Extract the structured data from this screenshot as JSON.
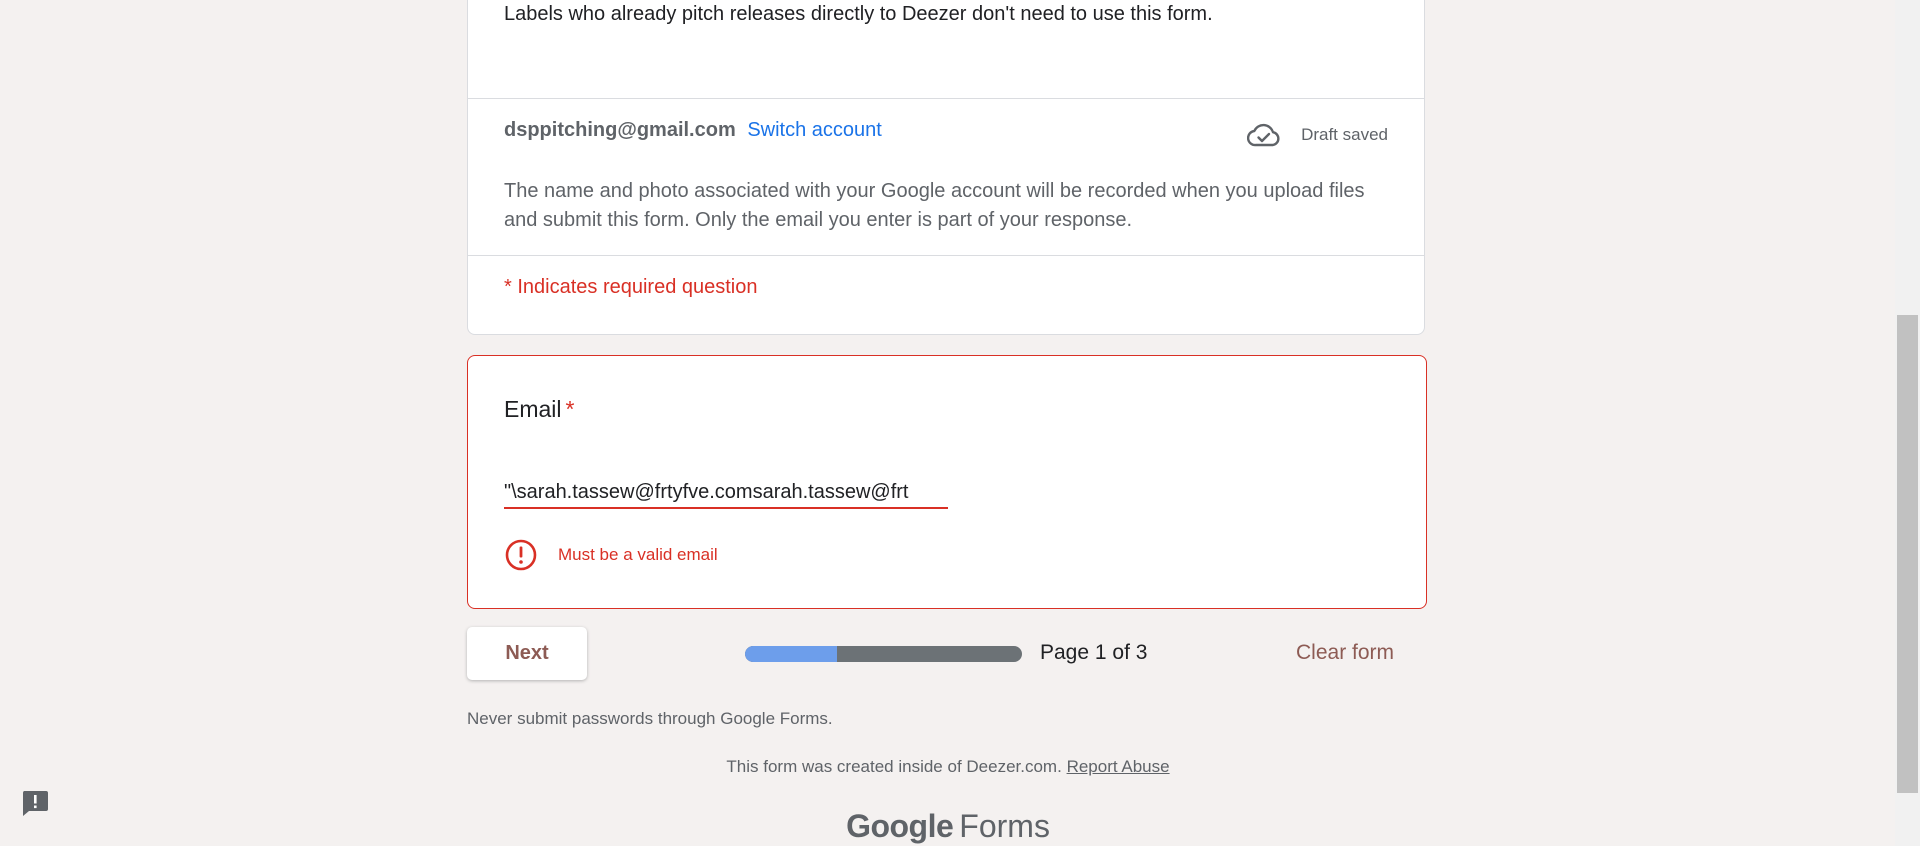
{
  "header": {
    "intro_text": "Labels who already pitch releases directly to Deezer don't need to use this form.",
    "account_email": "dsppitching@gmail.com",
    "switch_account_label": "Switch account",
    "draft_status": "Draft saved",
    "draft_icon": "cloud-done-icon",
    "privacy_note": "The name and photo associated with your Google account will be recorded when you upload files and submit this form. Only the email you enter is part of your response.",
    "required_note": "* Indicates required question"
  },
  "email_question": {
    "title": "Email",
    "required_marker": "*",
    "value": "\"\\sarah.tassew@frtyfve.comsarah.tassew@frt",
    "error_icon": "error-icon",
    "error_message": "Must be a valid email"
  },
  "navigation": {
    "next_label": "Next",
    "progress_fraction": 0.333,
    "page_indicator": "Page 1 of 3",
    "clear_form_label": "Clear form"
  },
  "footer": {
    "password_warning": "Never submit passwords through Google Forms.",
    "created_note": "This form was created inside of Deezer.com.",
    "report_abuse_label": "Report Abuse",
    "logo_google": "Google",
    "logo_forms": "Forms"
  },
  "feedback": {
    "icon": "feedback-icon"
  },
  "colors": {
    "error": "#d93025",
    "link": "#1a73e8",
    "accent": "#8d5b54",
    "progress_fill": "#6d9eeb",
    "progress_track": "#6c7276",
    "background": "#f4f1f0"
  }
}
